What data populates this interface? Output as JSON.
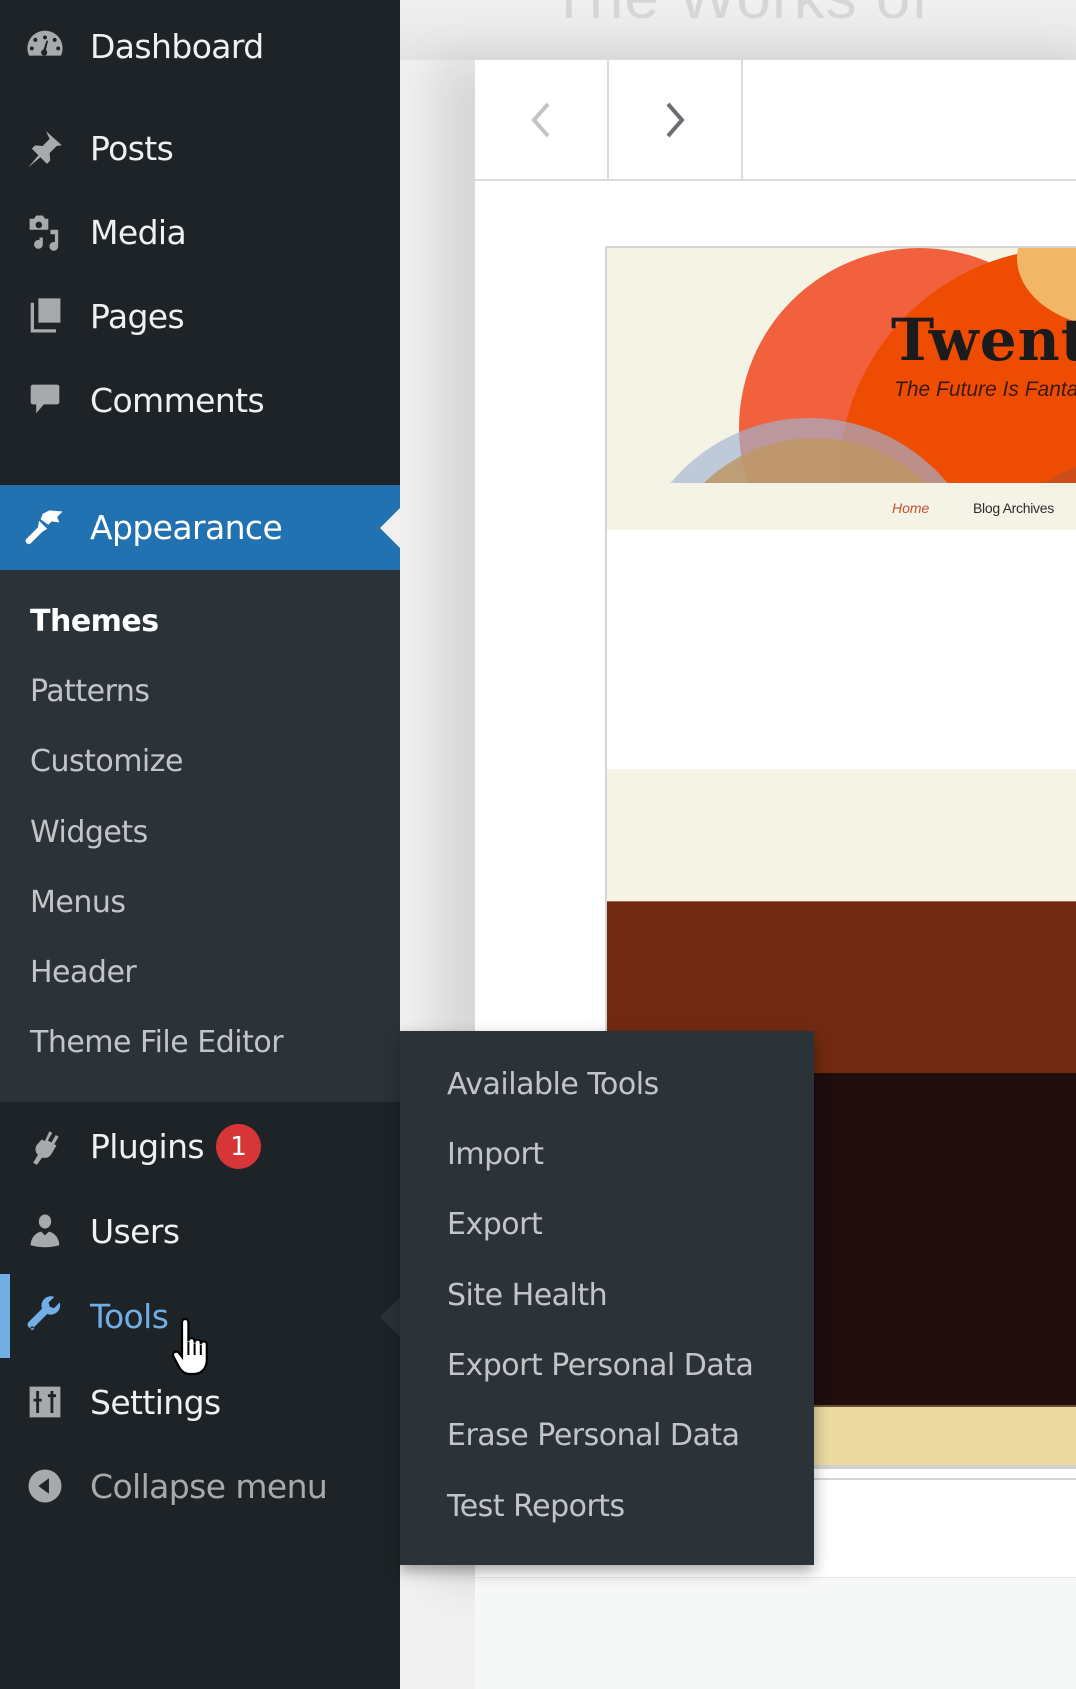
{
  "page": {
    "ghost_title": "The Works of"
  },
  "modal": {
    "prev_label": "Previous theme",
    "next_label": "Next theme",
    "screenshot": {
      "site_title": "Twent",
      "tagline": "The Future Is Fanta",
      "nav": [
        "Home",
        "Blog Archives"
      ]
    }
  },
  "sidebar": {
    "items": [
      {
        "label": "Dashboard",
        "icon": "dashboard-icon"
      },
      {
        "label": "Posts",
        "icon": "pushpin-icon"
      },
      {
        "label": "Media",
        "icon": "media-icon"
      },
      {
        "label": "Pages",
        "icon": "pages-icon"
      },
      {
        "label": "Comments",
        "icon": "comment-icon"
      },
      {
        "label": "Appearance",
        "icon": "paintbrush-icon",
        "current": true
      },
      {
        "label": "Plugins",
        "icon": "plugin-icon",
        "badge": "1"
      },
      {
        "label": "Users",
        "icon": "user-icon"
      },
      {
        "label": "Tools",
        "icon": "wrench-icon",
        "hover": true
      },
      {
        "label": "Settings",
        "icon": "settings-icon"
      },
      {
        "label": "Collapse menu",
        "icon": "collapse-icon"
      }
    ],
    "appearance_submenu": [
      {
        "label": "Themes",
        "current": true
      },
      {
        "label": "Patterns"
      },
      {
        "label": "Customize"
      },
      {
        "label": "Widgets"
      },
      {
        "label": "Menus"
      },
      {
        "label": "Header"
      },
      {
        "label": "Theme File Editor"
      }
    ]
  },
  "tools_flyout": {
    "items": [
      "Available Tools",
      "Import",
      "Export",
      "Site Health",
      "Export Personal Data",
      "Erase Personal Data",
      "Test Reports"
    ]
  },
  "colors": {
    "sidebar_bg": "#1d2327",
    "submenu_bg": "#2c3338",
    "accent": "#2271b1",
    "hover_blue": "#72aee6",
    "badge_red": "#d63638"
  }
}
